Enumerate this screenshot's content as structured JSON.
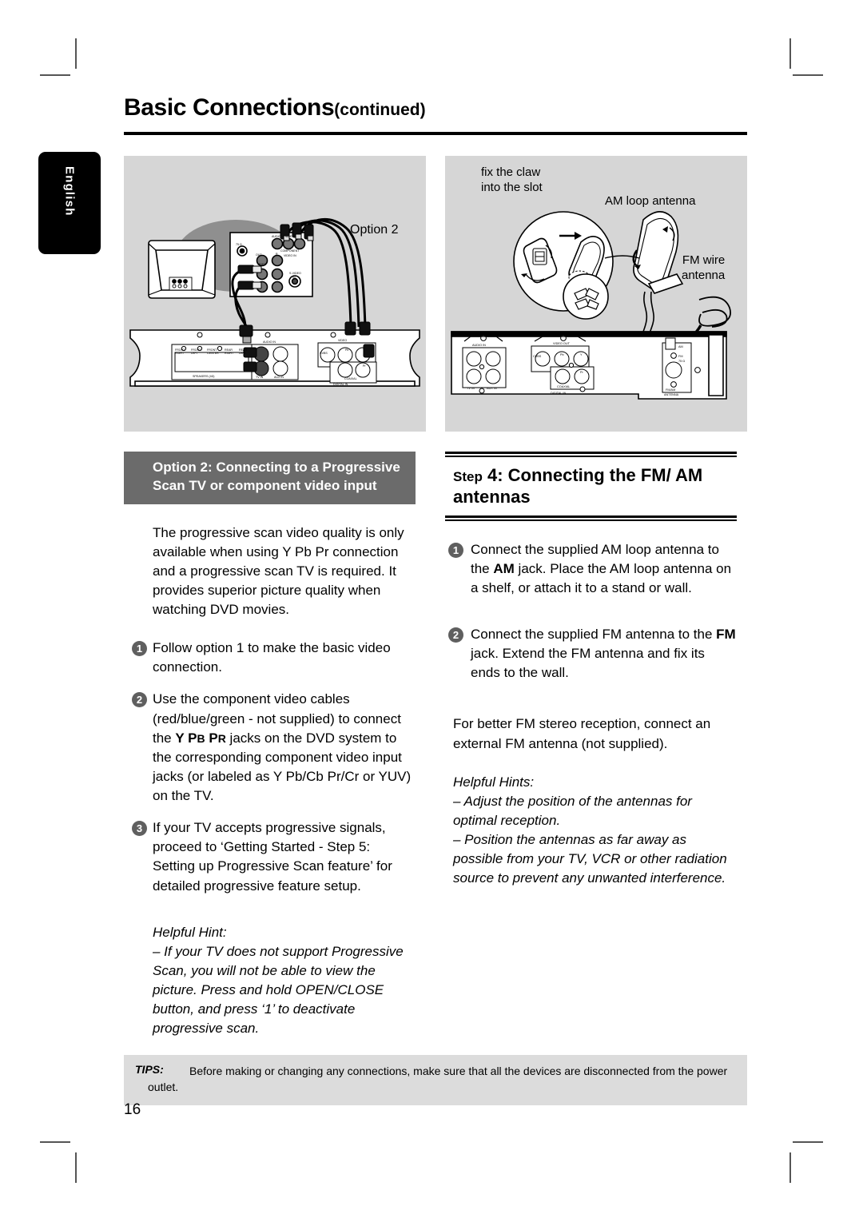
{
  "language_tab": {
    "label": "English"
  },
  "header": {
    "title": "Basic Connections",
    "continued": "(continued)"
  },
  "illustrations": {
    "left": {
      "name": "option-2-component-video-connection-diagram",
      "callout_option": "Option 2",
      "jack_labels": [
        "75 Ω",
        "AUDIO",
        "VIDEO",
        "COMPONENT VIDEO IN",
        "S-VIDEO IN",
        "OUT",
        "L",
        "R",
        "FRONT RIGHT",
        "FRONT LEFT",
        "CENTER",
        "REAR RIGHT",
        "REAR LEFT",
        "SPEAKERS (4Ω)",
        "TV IN",
        "AUX IN",
        "AUDIO IN",
        "VIDEO OUT",
        "COAXIAL",
        "DIGITAL IN",
        "Pb",
        "Pr",
        "Y"
      ]
    },
    "right": {
      "name": "fm-am-antenna-connection-diagram",
      "callout_claw": "fix the claw\ninto the slot",
      "callout_am_loop": "AM loop antenna",
      "callout_fm_wire": "FM wire\nantenna",
      "jack_labels": [
        "AUDIO IN",
        "TV IN",
        "AUX IN",
        "VIDEO OUT",
        "COAXIAL",
        "DIGITAL IN",
        "CVBS",
        "Pb",
        "Y",
        "Pr",
        "AM",
        "FM 75 Ω",
        "FM/AM ANTENNA"
      ]
    }
  },
  "left_column": {
    "option_heading": "Option 2: Connecting to a Progressive Scan TV or component video input",
    "intro": "The progressive scan video quality is only available when using Y Pb Pr connection and a progressive scan TV is required. It provides superior picture quality when watching DVD movies.",
    "steps": [
      {
        "number": "1",
        "text": "Follow option 1 to make the basic video connection."
      },
      {
        "number": "2",
        "text_before": "Use the component video cables (red/blue/green - not supplied) to connect the ",
        "bold_y": "Y",
        "bold_pb_cap": "P",
        "bold_pb_small": "B",
        "bold_pr_cap": "P",
        "bold_pr_small": "R",
        "text_after": " jacks on the DVD system to the corresponding component video input jacks (or labeled as Y Pb/Cb Pr/Cr or YUV) on the TV."
      },
      {
        "number": "3",
        "text": "If your TV accepts progressive signals, proceed to ‘Getting Started - Step 5: Setting up Progressive Scan feature’ for detailed progressive feature setup."
      }
    ],
    "hint_title": "Helpful Hint:",
    "hint_body": "– If your TV does not support Progressive Scan, you will not be able to view the picture. Press and hold OPEN/CLOSE button, and press ‘1’ to deactivate progressive scan."
  },
  "right_column": {
    "step_label": "Step",
    "step_number": "4:",
    "step_title": "Connecting the FM/ AM antennas",
    "step_heading_full": "Step 4: Connecting the FM/ AM antennas",
    "steps": [
      {
        "number": "1",
        "text_before": "Connect the supplied AM loop antenna to the ",
        "bold": "AM",
        "text_after": " jack.  Place the AM loop antenna on a shelf, or attach it to a stand or wall."
      },
      {
        "number": "2",
        "text_before": "Connect the supplied FM antenna to the ",
        "bold": "FM",
        "text_after": " jack.  Extend the FM antenna and fix its ends to the wall."
      }
    ],
    "paragraph": "For better FM stereo reception, connect an external FM antenna (not supplied).",
    "hint_title": "Helpful Hints:",
    "hint_body_1": "– Adjust the position of the antennas for optimal reception.",
    "hint_body_2": "– Position the antennas as far away as possible from your TV, VCR or other radiation source to prevent any unwanted interference."
  },
  "footer": {
    "tips_label": "TIPS:",
    "tips_text": "Before making or changing any connections, make sure that all the devices are disconnected from the power outlet.",
    "page_number": "16"
  },
  "colors": {
    "option_band": "#6b6b6b",
    "illustration_bg": "#d6d6d6",
    "tips_bg": "#dcdcdc",
    "badge": "#5f5f5f",
    "tab": "#000000"
  }
}
